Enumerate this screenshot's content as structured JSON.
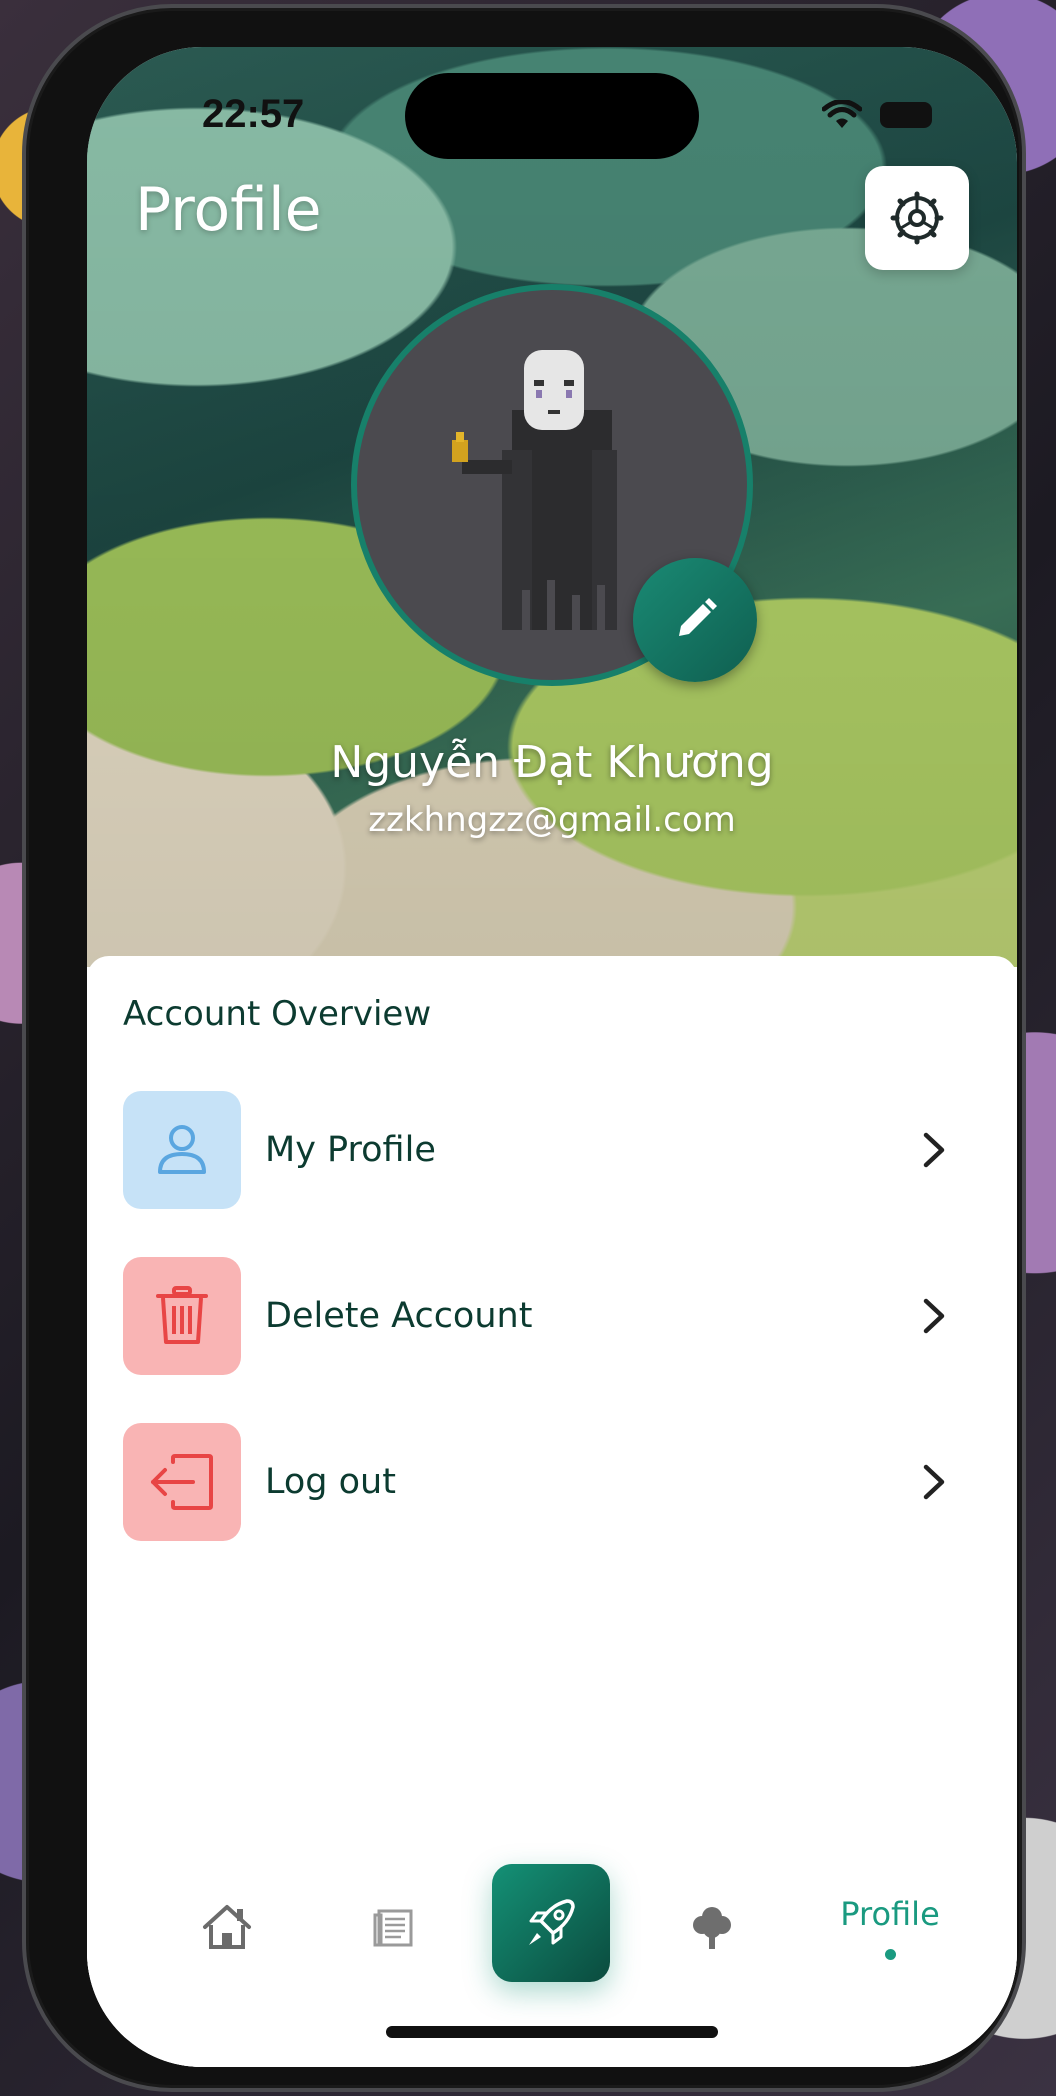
{
  "status_bar": {
    "time": "22:57"
  },
  "header": {
    "title": "Profile"
  },
  "user": {
    "name": "Nguyễn Đạt Khương",
    "email": "zzkhngzz@gmail.com"
  },
  "account_overview": {
    "title": "Account Overview",
    "items": [
      {
        "label": "My Profile",
        "icon": "user-icon",
        "bg": "#c6e2f7",
        "fg": "#5aa6e0"
      },
      {
        "label": "Delete Account",
        "icon": "trash-icon",
        "bg": "#f9b4b4",
        "fg": "#e84545"
      },
      {
        "label": "Log out",
        "icon": "logout-icon",
        "bg": "#f9b4b4",
        "fg": "#e84545"
      }
    ]
  },
  "tabbar": {
    "tabs": [
      {
        "icon": "home-icon"
      },
      {
        "icon": "news-icon"
      },
      {
        "icon": "rocket-icon"
      },
      {
        "icon": "tree-icon"
      },
      {
        "label": "Profile",
        "active": true
      }
    ]
  },
  "colors": {
    "accent": "#1a9a80",
    "text_dark": "#0c3b30"
  }
}
